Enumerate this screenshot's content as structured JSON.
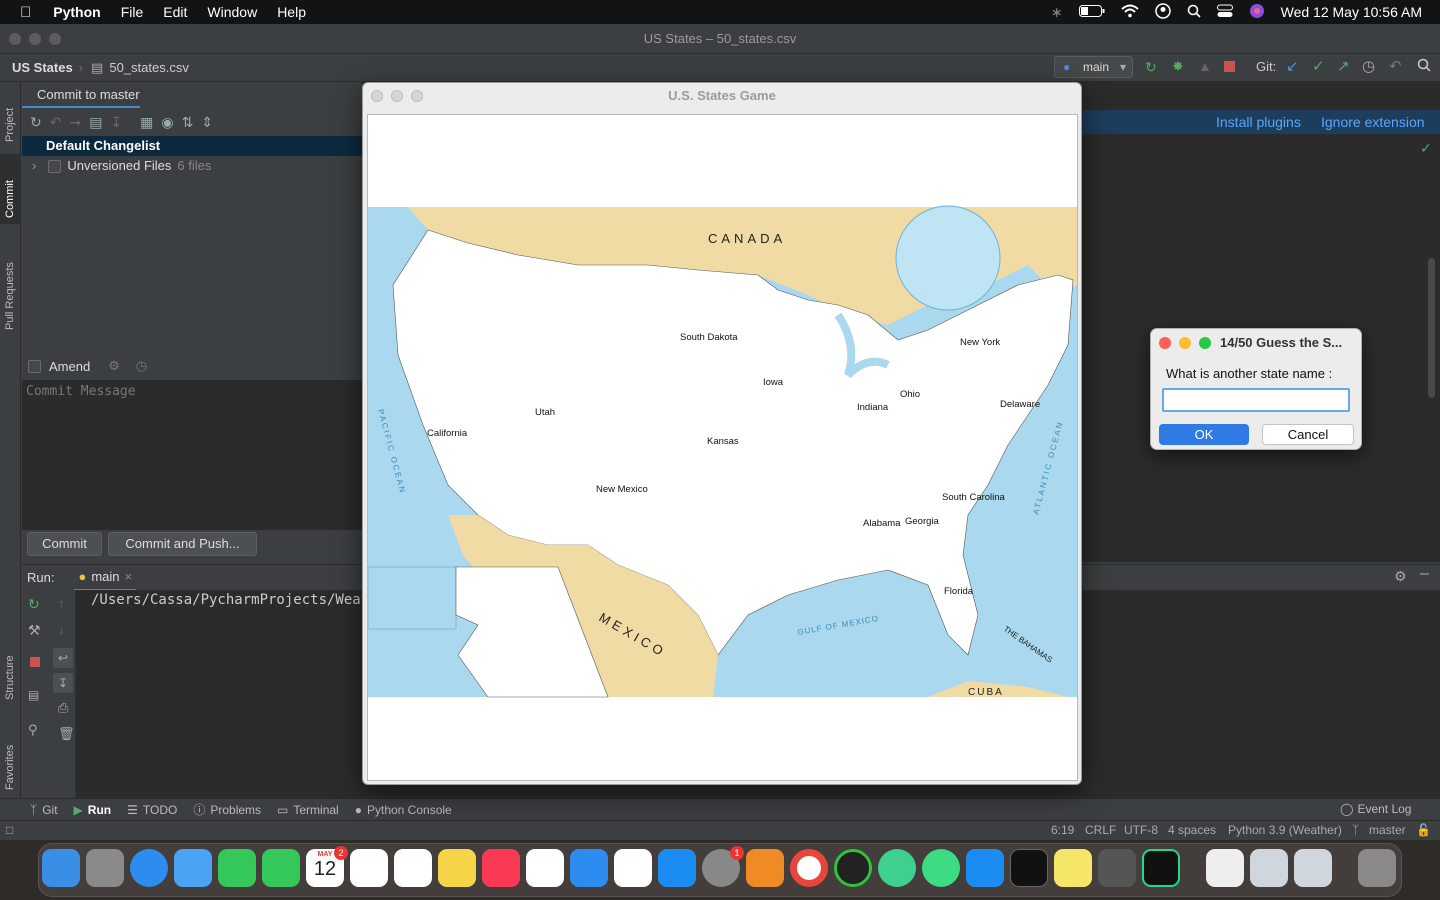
{
  "menubar": {
    "app": "Python",
    "items": [
      "File",
      "Edit",
      "Window",
      "Help"
    ],
    "clock": "Wed 12 May  10:56 AM"
  },
  "ide": {
    "window_title": "US States – 50_states.csv",
    "breadcrumb_project": "US States",
    "breadcrumb_file": "50_states.csv",
    "run_config": "main",
    "git_label": "Git:",
    "banner_install": "Install plugins",
    "banner_ignore": "Ignore extension"
  },
  "left_stripe": {
    "project": "Project",
    "commit": "Commit",
    "pull_requests": "Pull Requests",
    "structure": "Structure",
    "favorites": "Favorites"
  },
  "commit_panel": {
    "tab": "Commit to master",
    "changelist": "Default Changelist",
    "unversioned": "Unversioned Files",
    "unversioned_count": "6 files",
    "amend": "Amend",
    "message_placeholder": "Commit Message",
    "commit_button": "Commit",
    "commit_push_button": "Commit and Push..."
  },
  "run_panel": {
    "label": "Run:",
    "tab": "main",
    "output": "/Users/Cassa/PycharmProjects/Weath"
  },
  "bottom_tools": [
    "Git",
    "Run",
    "TODO",
    "Problems",
    "Terminal",
    "Python Console"
  ],
  "event_log": "Event Log",
  "status": {
    "position": "6:19",
    "line_sep": "CRLF",
    "encoding": "UTF-8",
    "indent": "4 spaces",
    "interpreter": "Python 3.9 (Weather)",
    "branch": "master"
  },
  "game": {
    "title": "U.S. States Game",
    "map_labels": {
      "canada": "CANADA",
      "mexico": "MEXICO",
      "pacific": "PACIFIC OCEAN",
      "atlantic": "ATLANTIC OCEAN",
      "gulf": "GULF OF MEXICO",
      "bahamas": "THE BAHAMAS",
      "cuba": "CUBA"
    },
    "guessed_states": [
      "South Dakota",
      "Iowa",
      "Utah",
      "California",
      "Kansas",
      "New Mexico",
      "Indiana",
      "Ohio",
      "New York",
      "Delaware",
      "South Carolina",
      "Alabama",
      "Georgia",
      "Florida"
    ]
  },
  "dialog": {
    "title": "14/50 Guess the S...",
    "prompt": "What is another state name :",
    "input_value": "",
    "ok": "OK",
    "cancel": "Cancel"
  },
  "dock": {
    "calendar_month": "MAY",
    "calendar_day": "12",
    "calendar_badge": "2",
    "settings_badge": "1"
  }
}
